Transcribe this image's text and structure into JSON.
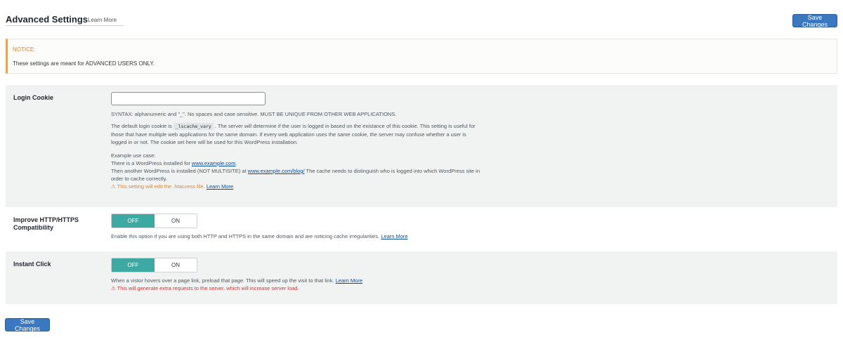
{
  "header": {
    "title": "Advanced Settings",
    "learn_more": "Learn More",
    "save_label": "Save Changes"
  },
  "notice": {
    "title": "NOTICE:",
    "text": "These settings are meant for ADVANCED USERS ONLY."
  },
  "login_cookie": {
    "label": "Login Cookie",
    "value": "",
    "syntax": "SYNTAX: alphanumeric and \"_\". No spaces and case sensitive. MUST BE UNIQUE FROM OTHER WEB APPLICATIONS.",
    "desc_before_code": "The default login cookie is",
    "code": "_lscache_vary",
    "desc_after_code": ". The server will determine if the user is logged in based on the existance of this cookie. This setting is useful for those that have multiple web applications for the same domain. If every web application uses the same cookie, the server may confuse whether a user is logged in or not. The cookie set here will be used for this WordPress installation.",
    "example_title": "Example use case:",
    "example_line1_prefix": "There is a WordPress installed for",
    "example_line1_link": "www.example.com",
    "example_line1_suffix": ".",
    "example_line2_prefix": "Then another WordPress is installed (NOT MULTISITE) at",
    "example_line2_link": "www.example.com/blog/",
    "example_line2_suffix": "The cache needs to distinguish who is logged into which WordPress site in order to cache correctly.",
    "warning": "⚠ This setting will edit the .htaccess file.",
    "warning_link": "Learn More"
  },
  "improve_https": {
    "label": "Improve HTTP/HTTPS Compatibility",
    "off_label": "OFF",
    "on_label": "ON",
    "state": "off",
    "desc": "Enable this option if you are using both HTTP and HTTPS in the same domain and are noticing cache irregularities.",
    "desc_link": "Learn More"
  },
  "instant_click": {
    "label": "Instant Click",
    "off_label": "OFF",
    "on_label": "ON",
    "state": "off",
    "desc": "When a vistor hovers over a page link, preload that page. This will speed up the visit to that link.",
    "desc_link": "Learn More",
    "warning": "⚠ This will generate extra requests to the server, which will increase server load."
  },
  "colors": {
    "primary_button": "#3a79bf",
    "toggle_active": "#3ea9a2",
    "notice_border": "#e0a55a",
    "warning_orange": "#d4863a",
    "warning_red": "#c33939"
  }
}
